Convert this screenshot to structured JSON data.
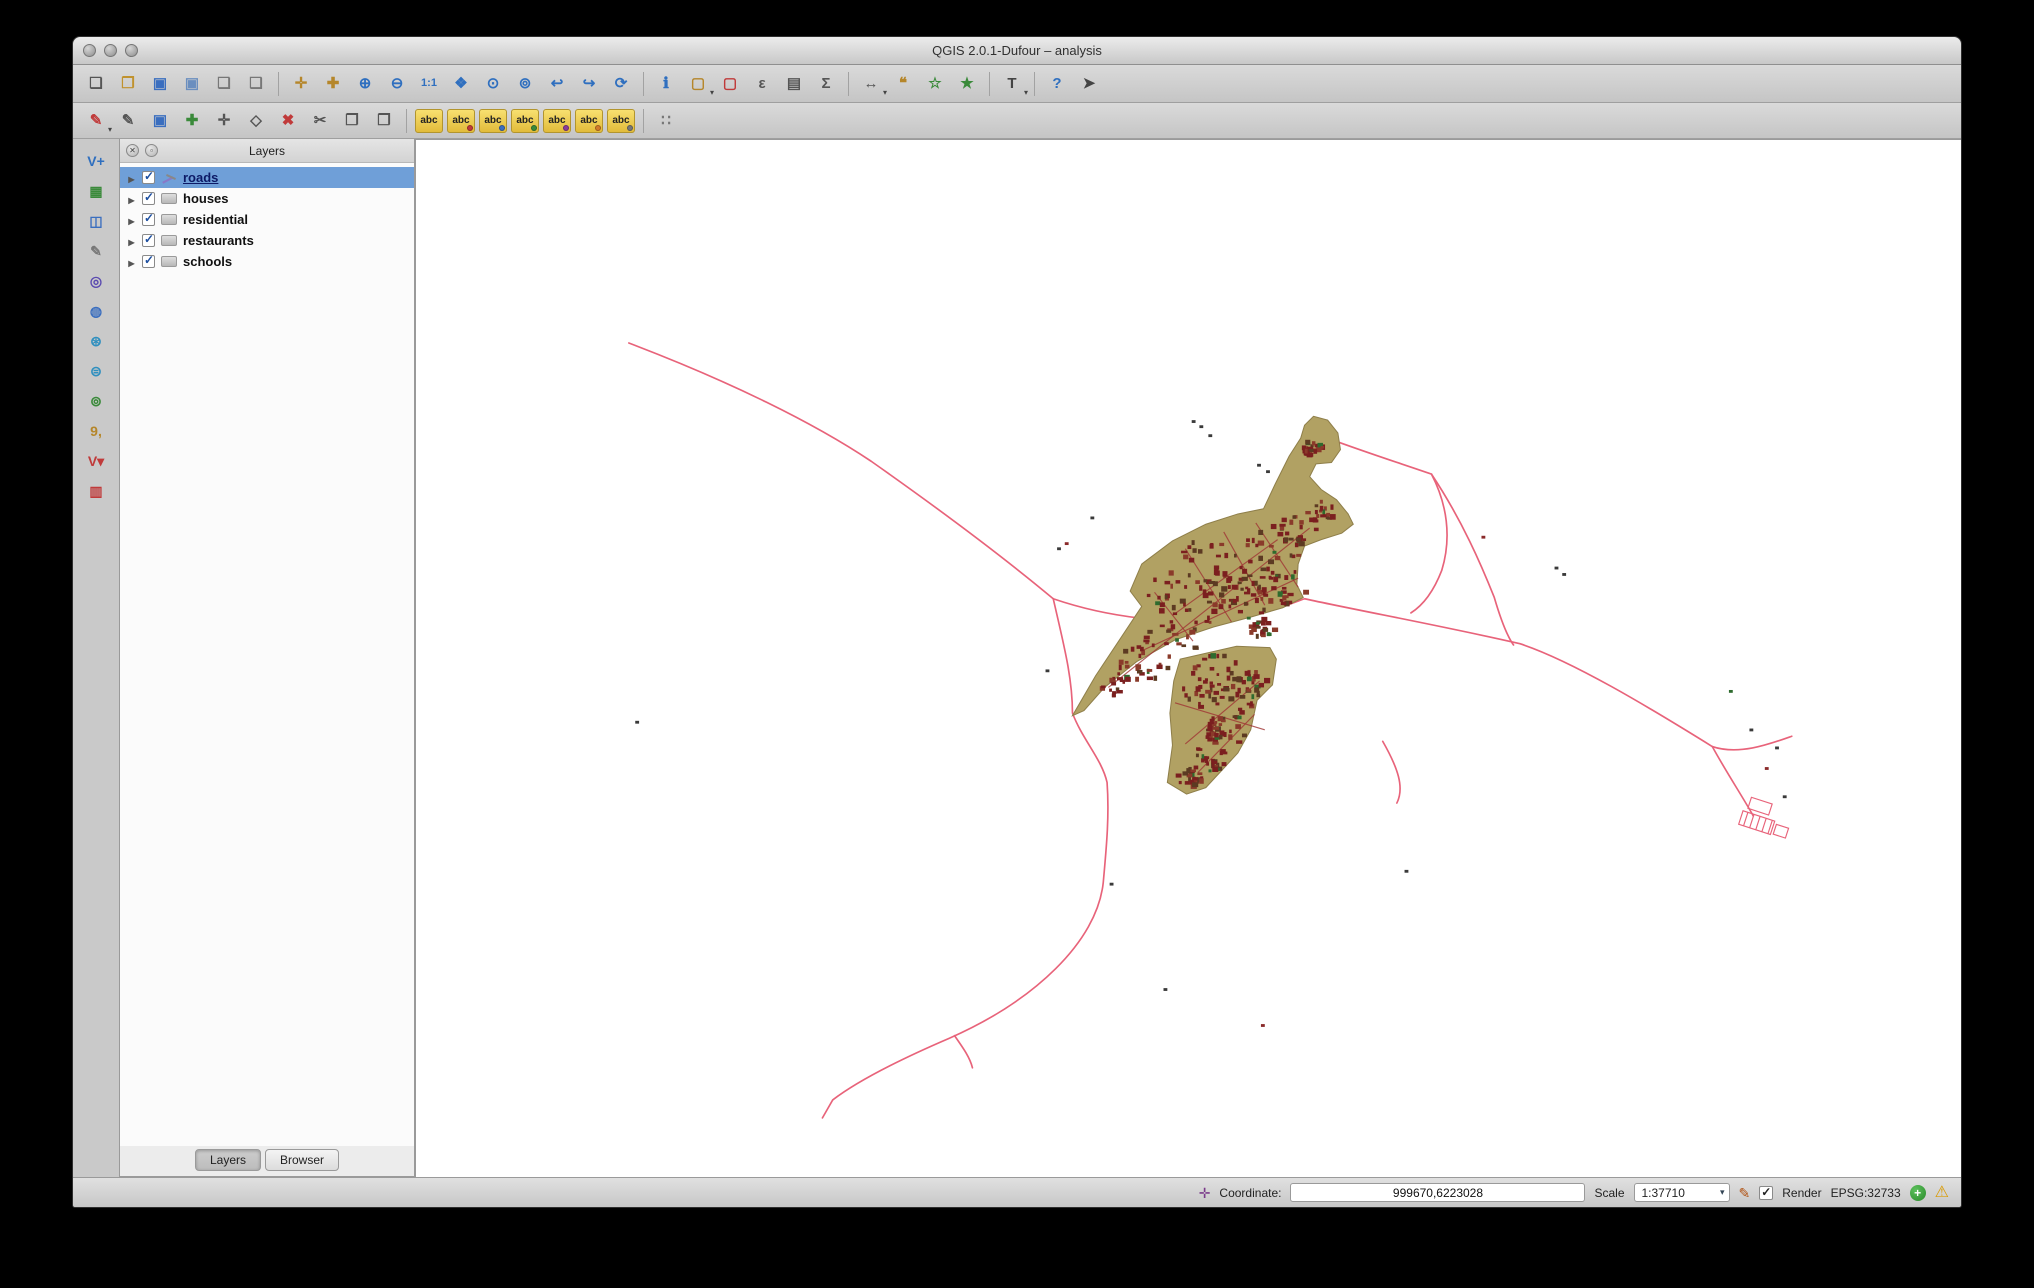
{
  "window": {
    "title": "QGIS 2.0.1-Dufour – analysis"
  },
  "colors": {
    "selection": "#6f9fd8",
    "road": "#e8637a",
    "town_fill": "#b1a163",
    "town_border": "#8f7f4a",
    "street": "#a03434",
    "building": "#7b1f1f",
    "building_alt": "#8a3a2a",
    "building_dark": "#5c3a22",
    "green": "#2e6b2e",
    "mark": "#3a3a3a"
  },
  "toolbars": {
    "main": [
      {
        "n": "new-project",
        "g": "❏",
        "c": "#555"
      },
      {
        "n": "open-project",
        "g": "❒",
        "c": "#c0922e"
      },
      {
        "n": "save-project",
        "g": "▣",
        "c": "#3a6ebf"
      },
      {
        "n": "save-project-as",
        "g": "▣",
        "c": "#6a8ebf"
      },
      {
        "n": "new-print-composer",
        "g": "❏",
        "c": "#777"
      },
      {
        "n": "composer-manager",
        "g": "❑",
        "c": "#777"
      },
      {
        "sep": true
      },
      {
        "n": "pan-map",
        "g": "✛",
        "c": "#b5862a"
      },
      {
        "n": "pan-to-selection",
        "g": "✚",
        "c": "#b5862a"
      },
      {
        "n": "zoom-in",
        "g": "⊕",
        "c": "#2f6fbf"
      },
      {
        "n": "zoom-out",
        "g": "⊖",
        "c": "#2f6fbf"
      },
      {
        "n": "zoom-native",
        "g": "1:1",
        "c": "#2f6fbf",
        "small": true
      },
      {
        "n": "zoom-full",
        "g": "❖",
        "c": "#2f6fbf"
      },
      {
        "n": "zoom-to-selection",
        "g": "⊙",
        "c": "#2f6fbf"
      },
      {
        "n": "zoom-to-layer",
        "g": "⊚",
        "c": "#2f6fbf"
      },
      {
        "n": "zoom-last",
        "g": "↩",
        "c": "#2f6fbf"
      },
      {
        "n": "zoom-next",
        "g": "↪",
        "c": "#2f6fbf"
      },
      {
        "n": "map-refresh",
        "g": "⟳",
        "c": "#2f6fbf"
      },
      {
        "sep": true
      },
      {
        "n": "identify-features",
        "g": "ℹ",
        "c": "#2f6fbf"
      },
      {
        "n": "select-features",
        "g": "▢",
        "c": "#b5862a",
        "dd": true
      },
      {
        "n": "deselect-features",
        "g": "▢",
        "c": "#c03a3a"
      },
      {
        "n": "select-by-expression",
        "g": "ε",
        "c": "#555"
      },
      {
        "n": "open-attribute-table",
        "g": "▤",
        "c": "#555"
      },
      {
        "n": "field-calculator",
        "g": "Σ",
        "c": "#555"
      },
      {
        "sep": true
      },
      {
        "n": "measure-line",
        "g": "↔",
        "c": "#555",
        "dd": true
      },
      {
        "n": "map-tips",
        "g": "❝",
        "c": "#b5862a"
      },
      {
        "n": "new-bookmark",
        "g": "☆",
        "c": "#3a8a3a"
      },
      {
        "n": "show-bookmarks",
        "g": "★",
        "c": "#3a8a3a"
      },
      {
        "sep": true
      },
      {
        "n": "text-annotation",
        "g": "T",
        "c": "#444",
        "dd": true
      },
      {
        "sep": true
      },
      {
        "n": "help-contents",
        "g": "?",
        "c": "#2f6fbf"
      },
      {
        "n": "whats-this",
        "g": "➤",
        "c": "#444"
      }
    ],
    "edit": [
      {
        "n": "current-edits",
        "g": "✎",
        "c": "#c03a3a",
        "dd": true
      },
      {
        "n": "toggle-editing",
        "g": "✎",
        "c": "#555"
      },
      {
        "n": "save-layer-edits",
        "g": "▣",
        "c": "#3a6ebf"
      },
      {
        "n": "add-feature",
        "g": "✚",
        "c": "#3a8a3a"
      },
      {
        "n": "move-feature",
        "g": "✛",
        "c": "#555"
      },
      {
        "n": "node-tool",
        "g": "◇",
        "c": "#555"
      },
      {
        "n": "delete-selected",
        "g": "✖",
        "c": "#c03a3a"
      },
      {
        "n": "cut-features",
        "g": "✂",
        "c": "#555"
      },
      {
        "n": "copy-features",
        "g": "❐",
        "c": "#555"
      },
      {
        "n": "paste-features",
        "g": "❒",
        "c": "#555"
      },
      {
        "sep": true
      },
      {
        "abc": true,
        "n": "layer-labeling"
      },
      {
        "abc": true,
        "n": "label-pin",
        "badge": "#c03a3a"
      },
      {
        "abc": true,
        "n": "label-highlight-pinned",
        "badge": "#3a6ebf"
      },
      {
        "abc": true,
        "n": "label-move",
        "badge": "#3a8a3a"
      },
      {
        "abc": true,
        "n": "label-rotate",
        "badge": "#8a3a9a"
      },
      {
        "abc": true,
        "n": "label-change",
        "badge": "#d07a2a"
      },
      {
        "abc": true,
        "n": "label-properties",
        "badge": "#777"
      },
      {
        "sep": true
      },
      {
        "n": "diagram-options",
        "g": "∷",
        "c": "#777"
      }
    ],
    "side": [
      {
        "n": "add-vector-layer",
        "g": "V+",
        "c": "#2f6fbf",
        "small": true
      },
      {
        "n": "add-raster-layer",
        "g": "▦",
        "c": "#3a8a3a"
      },
      {
        "n": "add-postgis-layer",
        "g": "◫",
        "c": "#3a6ebf"
      },
      {
        "n": "new-shapefile-layer",
        "g": "✎",
        "c": "#777"
      },
      {
        "n": "add-spatialite-layer",
        "g": "◎",
        "c": "#5a4ab0"
      },
      {
        "n": "add-mssql-layer",
        "g": "◍",
        "c": "#3a6ebf"
      },
      {
        "n": "add-wms-layer",
        "g": "⊛",
        "c": "#2f8fbf"
      },
      {
        "n": "add-wcs-layer",
        "g": "⊜",
        "c": "#2f8fbf"
      },
      {
        "n": "add-wfs-layer",
        "g": "⊚",
        "c": "#3a8a3a"
      },
      {
        "n": "add-delimited-text-layer",
        "g": "9,",
        "c": "#b5862a",
        "small": true
      },
      {
        "n": "add-oracle-layer",
        "g": "V▾",
        "c": "#c03a3a",
        "small": true
      },
      {
        "n": "remove-layer",
        "g": "▥",
        "c": "#c03a3a"
      }
    ]
  },
  "layers_panel": {
    "title": "Layers",
    "layers": [
      {
        "label": "roads",
        "checked": true,
        "selected": true,
        "symbol": "line"
      },
      {
        "label": "houses",
        "checked": true,
        "selected": false,
        "symbol": "group"
      },
      {
        "label": "residential",
        "checked": true,
        "selected": false,
        "symbol": "group"
      },
      {
        "label": "restaurants",
        "checked": true,
        "selected": false,
        "symbol": "group"
      },
      {
        "label": "schools",
        "checked": true,
        "selected": false,
        "symbol": "group"
      }
    ],
    "tabs": [
      {
        "label": "Layers",
        "active": true
      },
      {
        "label": "Browser",
        "active": false
      }
    ]
  },
  "status_bar": {
    "coordinate_label": "Coordinate:",
    "coordinate_value": "999670,6223028",
    "scale_label": "Scale",
    "scale_value": "1:37710",
    "render_label": "Render",
    "render_checked": true,
    "crs_label": "EPSG:32733"
  },
  "status_icons": {
    "mouse_position": "✛",
    "render_brush": "✎",
    "crs_status": "+",
    "log_messages": "⚠"
  },
  "panel_icons": {
    "close": "✕",
    "float": "▫"
  }
}
